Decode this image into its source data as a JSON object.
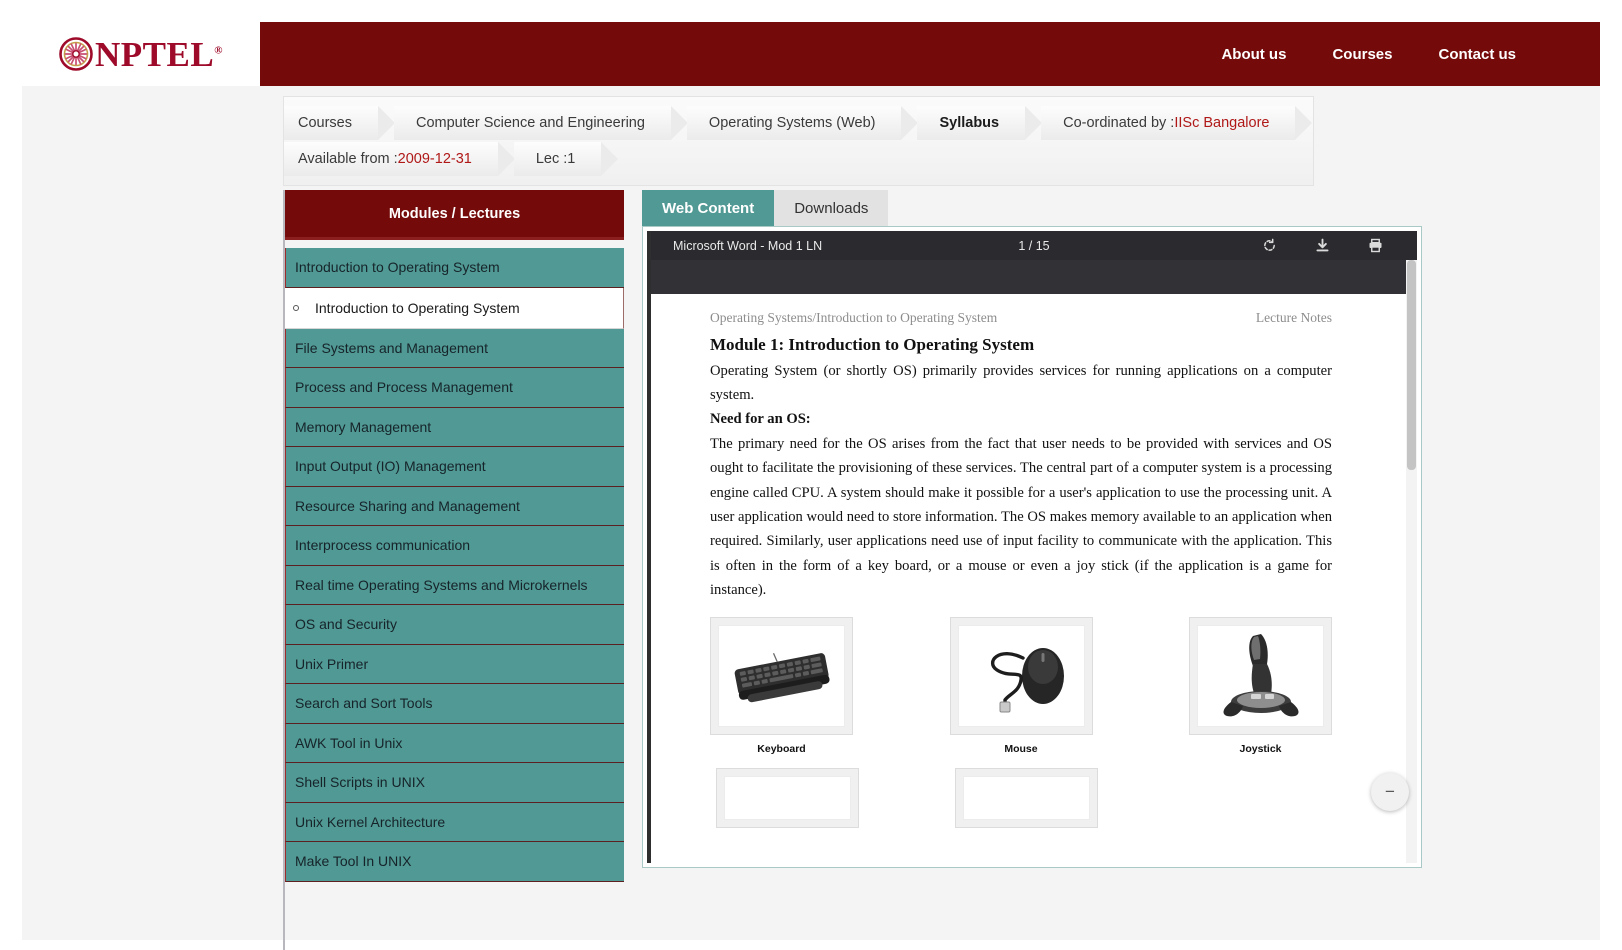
{
  "brand": {
    "name": "NPTEL",
    "registered": "®",
    "logo_icon": "nptel-wheel-icon",
    "color": "#9e0b2a"
  },
  "nav": {
    "items": [
      {
        "label": "About us"
      },
      {
        "label": "Courses"
      },
      {
        "label": "Contact us"
      }
    ]
  },
  "breadcrumb": {
    "row1": [
      {
        "label": "Courses",
        "bold": false
      },
      {
        "label": "Computer Science and Engineering",
        "bold": false
      },
      {
        "label": "Operating Systems (Web)",
        "bold": false
      },
      {
        "label": "Syllabus",
        "bold": true
      },
      {
        "label": "Co-ordinated by : ",
        "bold": false,
        "red_label": "IISc Bangalore"
      }
    ],
    "row2": [
      {
        "label": "Available from : ",
        "red_label": "2009-12-31"
      },
      {
        "label": "Lec :1"
      }
    ]
  },
  "sidebar": {
    "header": "Modules / Lectures",
    "items": [
      {
        "label": "Introduction to Operating System",
        "type": "module"
      },
      {
        "label": "Introduction to Operating System",
        "type": "lecture",
        "selected": true
      },
      {
        "label": "File Systems and Management",
        "type": "module"
      },
      {
        "label": "Process and Process Management",
        "type": "module"
      },
      {
        "label": "Memory Management",
        "type": "module"
      },
      {
        "label": "Input Output (IO) Management",
        "type": "module"
      },
      {
        "label": "Resource Sharing and Management",
        "type": "module"
      },
      {
        "label": "Interprocess communication",
        "type": "module"
      },
      {
        "label": "Real time Operating Systems and Microkernels",
        "type": "module"
      },
      {
        "label": "OS and Security",
        "type": "module"
      },
      {
        "label": "Unix Primer",
        "type": "module"
      },
      {
        "label": "Search and Sort Tools",
        "type": "module"
      },
      {
        "label": "AWK Tool in Unix",
        "type": "module"
      },
      {
        "label": "Shell Scripts in UNIX",
        "type": "module"
      },
      {
        "label": "Unix Kernel Architecture",
        "type": "module"
      },
      {
        "label": "Make Tool In UNIX",
        "type": "module"
      }
    ],
    "colors": {
      "header_bg": "#750a0a",
      "module_bg": "#519994",
      "selected_bg": "#ffffff"
    }
  },
  "tabs": [
    {
      "label": "Web Content",
      "active": true
    },
    {
      "label": "Downloads",
      "active": false
    }
  ],
  "pdf_viewer": {
    "title": "Microsoft Word - Mod 1 LN",
    "page_indicator": "1 / 15",
    "tools": [
      {
        "name": "rotate-icon"
      },
      {
        "name": "download-icon"
      },
      {
        "name": "print-icon"
      }
    ],
    "zoom_out_label": "−"
  },
  "document": {
    "header_left": "Operating Systems/Introduction to Operating System",
    "header_right": "Lecture Notes",
    "title": "Module 1: Introduction to Operating System",
    "para1": "Operating System (or shortly OS) primarily provides services for running applications on a computer system.",
    "subhead": "Need for an OS:",
    "para2": "The primary need for the OS arises from the fact that user needs to be provided with services and OS ought to facilitate the provisioning of these services. The central part of a computer system is a processing engine called CPU. A system should make it possible for a user's application to use the processing unit. A user application would need to store information. The OS makes memory available to an application when required. Similarly, user applications need use of input facility to communicate with the application. This is often in the form of a key board, or a mouse or even a joy stick (if the application is a game for instance).",
    "figures": [
      {
        "caption": "Keyboard",
        "icon": "keyboard-photo"
      },
      {
        "caption": "Mouse",
        "icon": "mouse-photo"
      },
      {
        "caption": "Joystick",
        "icon": "joystick-photo"
      }
    ]
  }
}
